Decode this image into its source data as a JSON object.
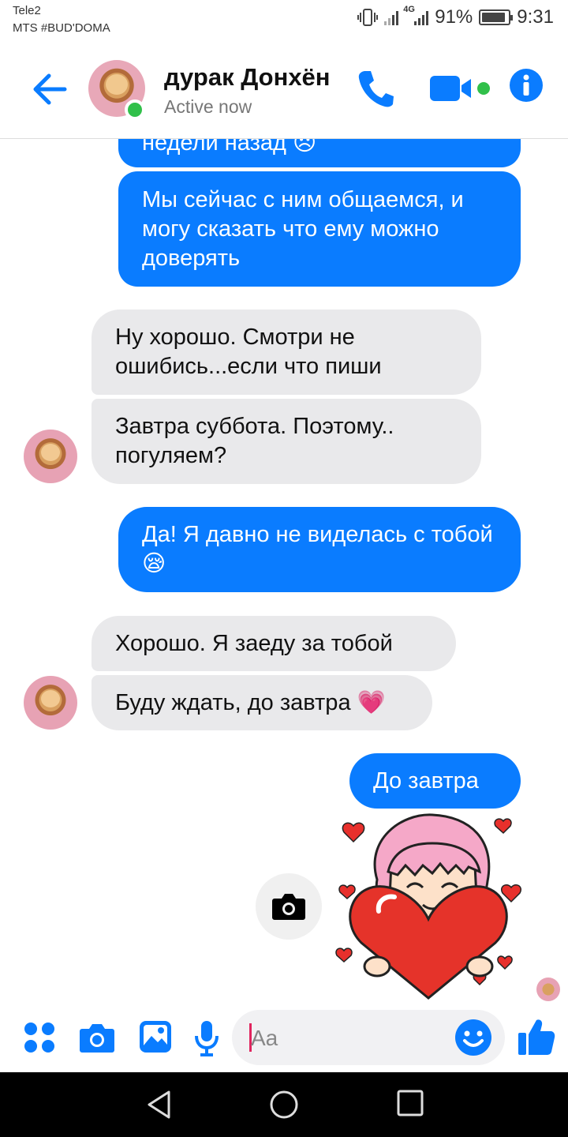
{
  "status_bar": {
    "carrier1": "Tele2",
    "carrier2": "MTS #BUD'DOMA",
    "network": "4G",
    "battery": "91%",
    "battery_level": 0.91,
    "time": "9:31"
  },
  "header": {
    "contact_name": "дурак Донхён",
    "status": "Active now",
    "accent": "#0a7cff",
    "online_color": "#31c04a"
  },
  "messages": [
    {
      "side": "out",
      "text": "недели назад 😞"
    },
    {
      "side": "out",
      "text": "Мы сейчас с ним общаемся, и могу сказать что ему можно доверять"
    },
    {
      "side": "in",
      "text": "Ну хорошо. Смотри не ошибись...если что пиши"
    },
    {
      "side": "in",
      "text": "Завтра суббота. Поэтому.. погуляем?"
    },
    {
      "side": "out",
      "text": "Да! Я давно не виделась с тобой 😪"
    },
    {
      "side": "in",
      "text": "Хорошо. Я заеду за тобой"
    },
    {
      "side": "in",
      "text": "Буду ждать, до завтра 💗"
    },
    {
      "side": "out",
      "text": "До завтра"
    }
  ],
  "sticker": {
    "icon": "girl-holding-heart-sticker"
  },
  "composer": {
    "placeholder": "Aa",
    "icons": [
      "apps-icon",
      "camera-icon",
      "gallery-icon",
      "microphone-icon",
      "emoji-icon",
      "like-icon"
    ]
  },
  "nav": {
    "icons": [
      "back-triangle-icon",
      "home-circle-icon",
      "recents-square-icon"
    ]
  }
}
